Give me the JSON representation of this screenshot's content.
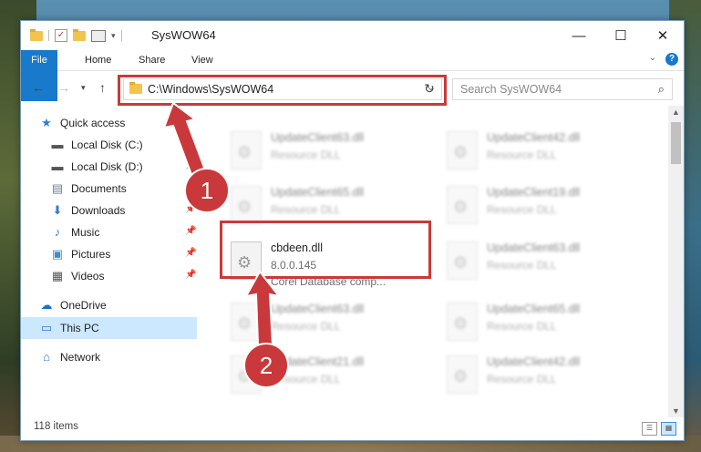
{
  "window": {
    "title": "SysWOW64",
    "minimize_glyph": "—",
    "maximize_glyph": "☐",
    "close_glyph": "✕"
  },
  "ribbon": {
    "tabs": [
      "File",
      "Home",
      "Share",
      "View"
    ],
    "help_label": "?"
  },
  "address": {
    "path": "C:\\Windows\\SysWOW64",
    "search_placeholder": "Search SysWOW64"
  },
  "sidebar": {
    "items": [
      {
        "label": "Quick access",
        "icon": "star-icon",
        "pinned": false
      },
      {
        "label": "Local Disk (C:)",
        "icon": "drive-icon",
        "pinned": false
      },
      {
        "label": "Local Disk (D:)",
        "icon": "drive-icon",
        "pinned": true
      },
      {
        "label": "Documents",
        "icon": "documents-icon",
        "pinned": true
      },
      {
        "label": "Downloads",
        "icon": "download-icon",
        "pinned": true
      },
      {
        "label": "Music",
        "icon": "music-icon",
        "pinned": true
      },
      {
        "label": "Pictures",
        "icon": "pictures-icon",
        "pinned": true
      },
      {
        "label": "Videos",
        "icon": "videos-icon",
        "pinned": true
      },
      {
        "label": "OneDrive",
        "icon": "cloud-icon",
        "pinned": false
      },
      {
        "label": "This PC",
        "icon": "computer-icon",
        "pinned": false,
        "selected": true
      },
      {
        "label": "Network",
        "icon": "network-icon",
        "pinned": false
      }
    ]
  },
  "files": {
    "highlighted": {
      "name": "cbdeen.dll",
      "version": "8.0.0.145",
      "description": "Corel Database comp..."
    },
    "blurred": [
      {
        "name": "UpdateClient63.dll",
        "sub": "Resource DLL"
      },
      {
        "name": "UpdateClient42.dll",
        "sub": "Resource DLL"
      },
      {
        "name": "UpdateClient65.dll",
        "sub": "Resource DLL"
      },
      {
        "name": "UpdateClient19.dll",
        "sub": "Resource DLL"
      },
      {
        "name": "UpdateClient63.dll",
        "sub": "Resource DLL"
      },
      {
        "name": "UpdateClient63.dll",
        "sub": "Resource DLL"
      },
      {
        "name": "UpdateClient65.dll",
        "sub": "Resource DLL"
      },
      {
        "name": "UpdateClient21.dll",
        "sub": "Resource DLL"
      },
      {
        "name": "UpdateClient42.dll",
        "sub": "Resource DLL"
      }
    ]
  },
  "status": {
    "item_count": "118 items"
  },
  "annotations": {
    "step1": "1",
    "step2": "2",
    "color": "#c9393b"
  }
}
